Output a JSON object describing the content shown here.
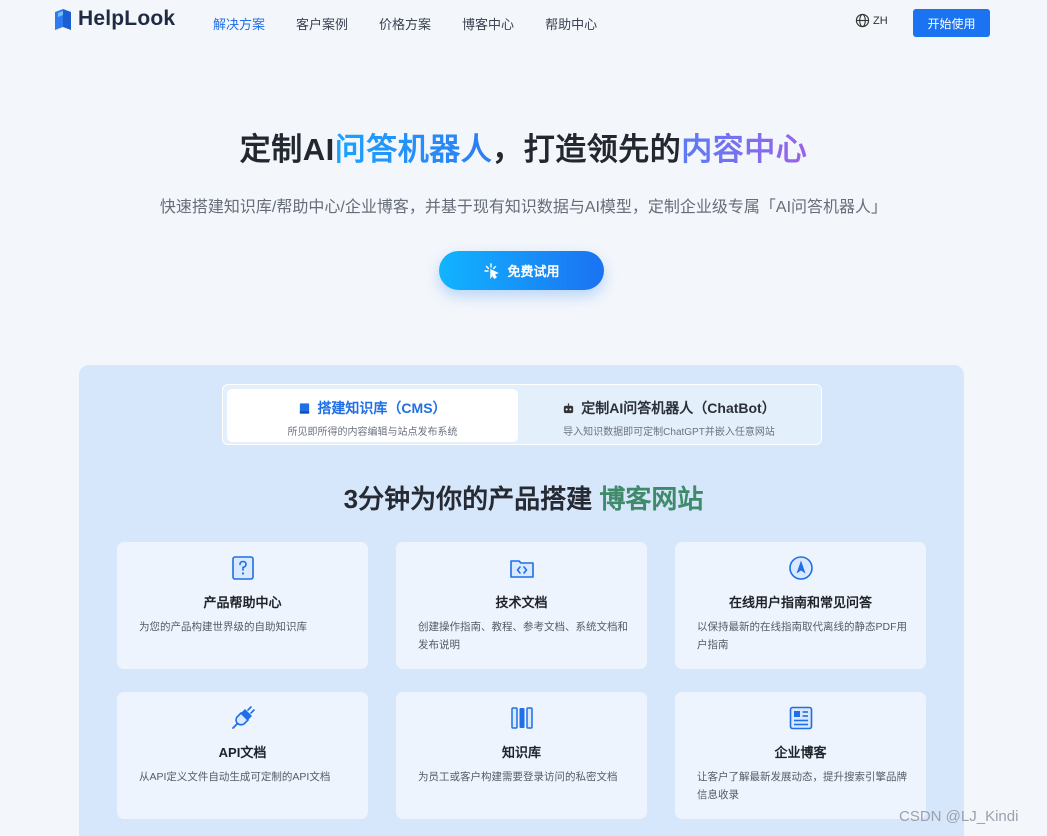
{
  "nav": {
    "logo_text": "HelpLook",
    "links": [
      "解决方案",
      "客户案例",
      "价格方案",
      "博客中心",
      "帮助中心"
    ],
    "lang": "ZH",
    "start_label": "开始使用"
  },
  "hero": {
    "title_a": "定制AI",
    "title_b": "问答机器人",
    "title_c": "，打造领先的",
    "title_d": "内容中心",
    "subtitle": "快速搭建知识库/帮助中心/企业博客，并基于现有知识数据与AI模型，定制企业级专属「AI问答机器人」",
    "trial_label": "免费试用"
  },
  "tabs": [
    {
      "title": "搭建知识库（CMS）",
      "desc": "所见即所得的内容编辑与站点发布系统",
      "icon": "book-icon"
    },
    {
      "title": "定制AI问答机器人（ChatBot）",
      "desc": "导入知识数据即可定制ChatGPT并嵌入任意网站",
      "icon": "robot-icon"
    }
  ],
  "section": {
    "title_a": "3分钟为你的产品搭建 ",
    "title_b": "博客网站"
  },
  "cards": [
    {
      "title": "产品帮助中心",
      "desc": "为您的产品构建世界级的自助知识库",
      "icon": "question-icon"
    },
    {
      "title": "技术文档",
      "desc": "创建操作指南、教程、参考文档、系统文档和发布说明",
      "icon": "code-folder-icon"
    },
    {
      "title": "在线用户指南和常见问答",
      "desc": "以保持最新的在线指南取代离线的静态PDF用户指南",
      "icon": "compass-icon"
    },
    {
      "title": "API文档",
      "desc": "从API定义文件自动生成可定制的API文档",
      "icon": "plug-icon"
    },
    {
      "title": "知识库",
      "desc": "为员工或客户构建需要登录访问的私密文档",
      "icon": "books-icon"
    },
    {
      "title": "企业博客",
      "desc": "让客户了解最新发展动态，提升搜索引擎品牌信息收录",
      "icon": "blog-layout-icon"
    }
  ],
  "watermark": "CSDN @LJ_Kindi",
  "colors": {
    "accent": "#1a73f0",
    "green": "#3e8a6a",
    "panel": "#d6e6fb"
  }
}
